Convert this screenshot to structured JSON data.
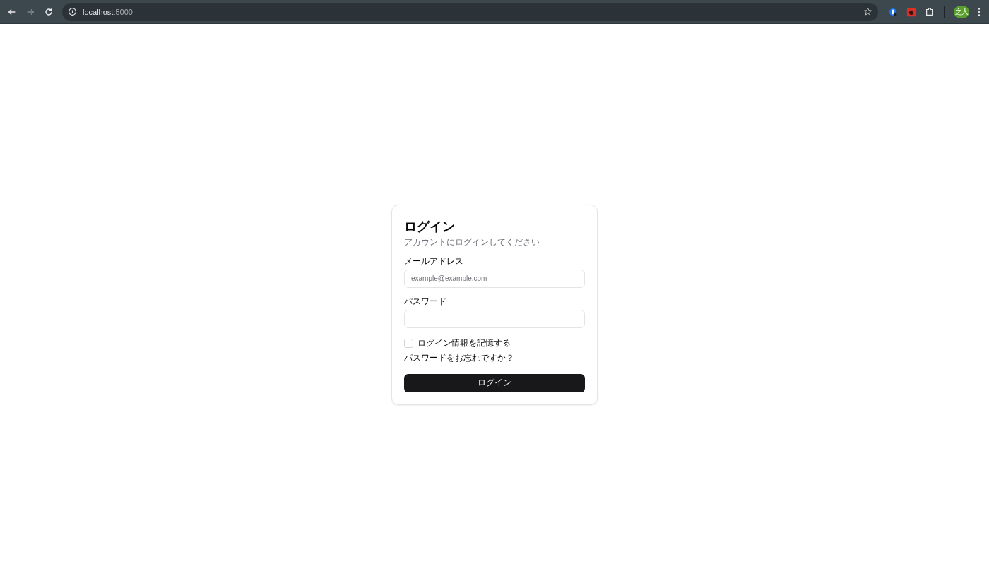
{
  "browser": {
    "url_host": "localhost",
    "url_port": ":5000",
    "avatar": "之人",
    "back_disabled": false,
    "forward_disabled": true
  },
  "login": {
    "title": "ログイン",
    "subtitle": "アカウントにログインしてください",
    "email": {
      "label": "メールアドレス",
      "placeholder": "example@example.com"
    },
    "password": {
      "label": "パスワード"
    },
    "remember": {
      "label": "ログイン情報を記憶する",
      "checked": false
    },
    "forgot": "パスワードをお忘れですか？",
    "submit": "ログイン"
  }
}
